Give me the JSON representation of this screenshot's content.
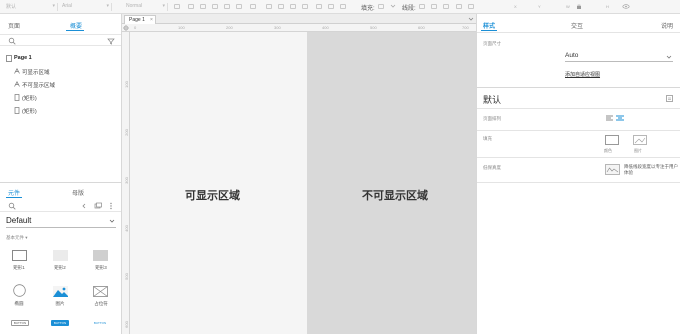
{
  "toolbar": {
    "style_dropdown": "默认",
    "font_dropdown": "Arial",
    "weight_dropdown": "Normal",
    "fill_label": "填充:",
    "line_label": "线段:",
    "coords": {
      "x": "X",
      "y": "Y",
      "w": "W",
      "h": "H"
    }
  },
  "left_panel": {
    "tabs": [
      "页面",
      "概要"
    ],
    "tree": {
      "page": "Page 1",
      "items": [
        "可显示区域",
        "不可显示区域",
        "(矩形)",
        "(矩形)"
      ]
    },
    "lib_tabs": [
      "元件",
      "母版"
    ],
    "library_name": "Default",
    "section_title": "基本元件 ▾",
    "widgets": [
      "矩形1",
      "矩形2",
      "矩形3",
      "椭圆",
      "图片",
      "占位符"
    ],
    "button_labels": [
      "BUTTON",
      "BUTTON",
      "BUTTON"
    ]
  },
  "canvas": {
    "page_tab": "Page 1",
    "ruler_h": [
      "0",
      "100",
      "200",
      "300",
      "400",
      "500",
      "600",
      "700"
    ],
    "ruler_v": [
      "100",
      "200",
      "300",
      "400",
      "500",
      "600"
    ],
    "visible_label": "可显示区域",
    "invisible_label": "不可显示区域"
  },
  "right_panel": {
    "tabs": [
      "样式",
      "交互",
      "说明"
    ],
    "size_label": "页面尺寸",
    "size_value": "Auto",
    "add_view_link": "添加自适应视图",
    "style_name": "默认",
    "align_label": "页面排列",
    "fill_label": "填充",
    "fill_options": [
      "颜色",
      "图片"
    ],
    "low_fidelity_label": "低保真度",
    "low_fidelity_text": "降低线段宽度以专注于用户体验"
  },
  "colors": {
    "accent": "#1b8fd6",
    "visible_area": "#f5f5f5",
    "invisible_area": "#d9d9d9"
  }
}
